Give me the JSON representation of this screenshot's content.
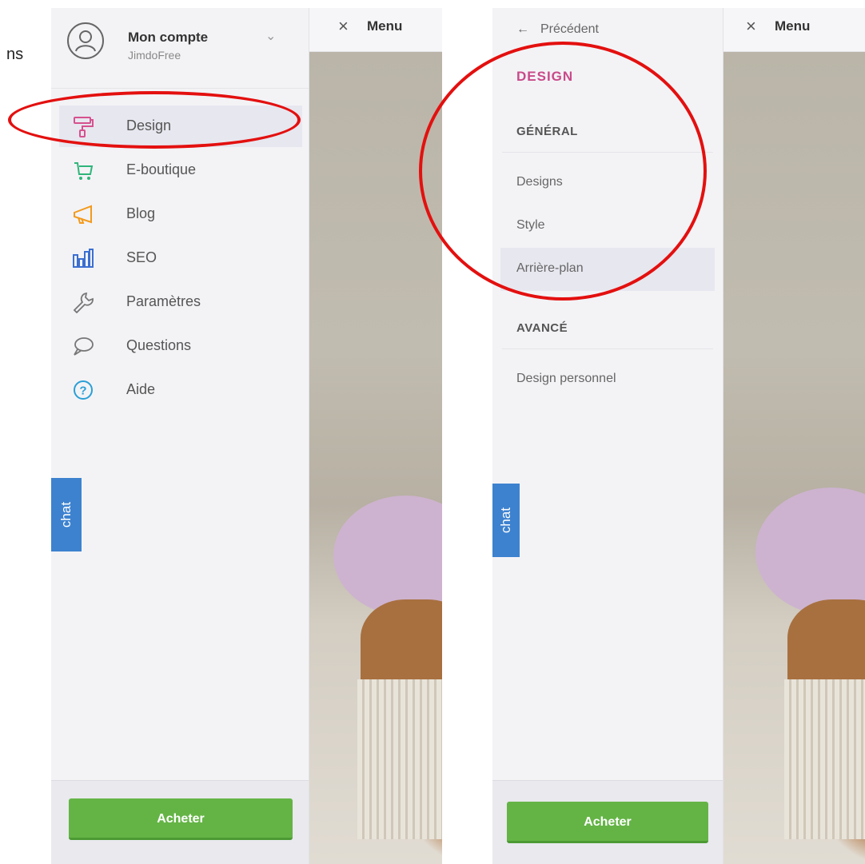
{
  "doc_fragment": "ns",
  "left": {
    "menu": {
      "close_icon": "×",
      "label": "Menu"
    },
    "account": {
      "name": "Mon compte",
      "plan": "JimdoFree"
    },
    "nav": [
      {
        "label": "Design",
        "icon": "paint-roller-icon",
        "color": "#d6518f",
        "active": true
      },
      {
        "label": "E-boutique",
        "icon": "cart-icon",
        "color": "#2fb57a",
        "active": false
      },
      {
        "label": "Blog",
        "icon": "megaphone-icon",
        "color": "#f39a1b",
        "active": false
      },
      {
        "label": "SEO",
        "icon": "bar-chart-icon",
        "color": "#3b6fd1",
        "active": false
      },
      {
        "label": "Paramètres",
        "icon": "wrench-icon",
        "color": "#777777",
        "active": false
      },
      {
        "label": "Questions",
        "icon": "speech-bubble-icon",
        "color": "#777777",
        "active": false
      },
      {
        "label": "Aide",
        "icon": "help-circle-icon",
        "color": "#2a9fd6",
        "active": false
      }
    ],
    "chat_label": "chat",
    "buy_label": "Acheter"
  },
  "right": {
    "back_arrow": "←",
    "back_label": "Précédent",
    "menu": {
      "close_icon": "×",
      "label": "Menu"
    },
    "title": "DESIGN",
    "section_general": "GÉNÉRAL",
    "items_general": [
      {
        "label": "Designs",
        "active": false
      },
      {
        "label": "Style",
        "active": false
      },
      {
        "label": "Arrière-plan",
        "active": true
      }
    ],
    "section_advanced": "AVANCÉ",
    "items_advanced": [
      {
        "label": "Design personnel",
        "active": false
      }
    ],
    "chat_label": "chat",
    "buy_label": "Acheter"
  },
  "colors": {
    "accent_pink": "#c94a8a",
    "chat_blue": "#3d82cf",
    "buy_green": "#64b445",
    "annotation_red": "#e3100f"
  }
}
